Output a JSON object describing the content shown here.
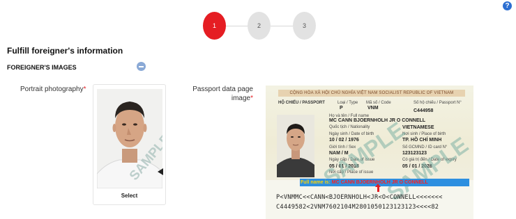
{
  "help_icon": "question-circle-icon",
  "steps": [
    {
      "label": "1",
      "state": "active"
    },
    {
      "label": "2",
      "state": "pending"
    },
    {
      "label": "3",
      "state": "pending"
    }
  ],
  "colors": {
    "accent": "#e51d23",
    "required": "#e51d23",
    "highlight": "#2d8fe0"
  },
  "page_title": "Fulfill foreigner's information",
  "section": {
    "title": "FOREIGNER'S IMAGES",
    "toggle_icon": "minus-circle-icon"
  },
  "portrait": {
    "label": "Portrait photography",
    "required_mark": "*",
    "watermark": "SAMPLE",
    "select_label": "Select"
  },
  "passport": {
    "label_line1": "Passport data page",
    "label_line2": "image",
    "required_mark": "*",
    "watermark": "SAMPLE",
    "header_text": "CỘNG HÒA XÃ HỘI CHỦ NGHĨA VIỆT NAM SOCIALIST REPUBLIC OF VIETNAM",
    "fields": {
      "passport_label": "HỘ CHIẾU / PASSPORT",
      "type_label": "Loại / Type",
      "type_value": "P",
      "code_label": "Mã số / Code",
      "code_value": "VNM",
      "number_label": "Số hộ chiếu / Passport N°",
      "number_value": "C444958",
      "surname_label": "Họ và tên / Full name",
      "name_value": "MC CANN BJOERNHOLH JR O CONNELL",
      "nationality_label": "Quốc tịch / Nationality",
      "nationality_value": "VIETNAMESE",
      "dob_label": "Ngày sinh / Date of birth",
      "dob_value": "10 / 02 / 1976",
      "pob_label": "Nơi sinh / Place of birth",
      "pob_value": "TP. HỒ CHÍ MINH",
      "sex_label": "Giới tính / Sex",
      "sex_value": "NAM / M",
      "id_label": "Số GCMND / ID card N°",
      "id_value": "123123123",
      "issue_label": "Ngày cấp / Date of issue",
      "issue_value": "05 / 01 / 2018",
      "expiry_label": "Có giá trị đến / Date of expiry",
      "expiry_value": "05 / 01 / 2028",
      "place_label": "Nơi cấp / Place of issue"
    },
    "full_name_prefix": "Full name is:",
    "full_name_value": "MC CANN BJOERNHOLH JR O CONNELL",
    "mrz_line1": "P<VNMMC<<CANN<BJOERNHOLH<JR<O<CONNELL<<<<<<<",
    "mrz_line2": "C4449582<2VNM7602104M2801050123123123<<<<82"
  },
  "arrow_icon": "caret-left-icon",
  "pointer_icon": "arrow-up-icon"
}
